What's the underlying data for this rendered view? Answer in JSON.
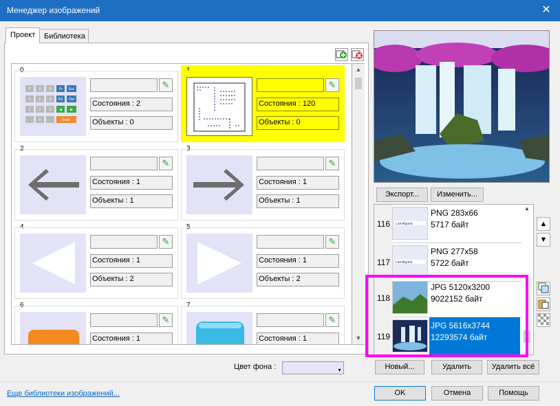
{
  "window": {
    "title": "Менеджер изображений",
    "close_glyph": "✕"
  },
  "tabs": [
    {
      "label": "Проект",
      "active": true
    },
    {
      "label": "Библиотека",
      "active": false
    }
  ],
  "cells": [
    {
      "index": "0",
      "states": "Состояния : 2",
      "objects": "Объекты : 0",
      "image": "keypad"
    },
    {
      "index": "1",
      "states": "Состояния : 120",
      "objects": "Объекты : 0",
      "image": "sheet",
      "selected": true
    },
    {
      "index": "2",
      "states": "Состояния : 1",
      "objects": "Объекты : 1",
      "image": "arrow-left"
    },
    {
      "index": "3",
      "states": "Состояния : 1",
      "objects": "Объекты : 1",
      "image": "arrow-right"
    },
    {
      "index": "4",
      "states": "Состояния : 1",
      "objects": "Объекты : 2",
      "image": "triangle-left"
    },
    {
      "index": "5",
      "states": "Состояния : 1",
      "objects": "Объекты : 2",
      "image": "triangle-right"
    },
    {
      "index": "6",
      "states": "Состояния : 1",
      "objects": "",
      "image": "orange-button"
    },
    {
      "index": "7",
      "states": "Состояния : 1",
      "objects": "",
      "image": "blue-button"
    }
  ],
  "preview_buttons": {
    "export": "Экспорт...",
    "edit": "Изменить..."
  },
  "library": [
    {
      "num": "116",
      "format": "PNG 283x66",
      "size": "5717 байт",
      "thumb_text": "Lanvtiguna"
    },
    {
      "num": "117",
      "format": "PNG 277x58",
      "size": "5722 байт",
      "thumb_text": "Lanvtiguna"
    },
    {
      "num": "118",
      "format": "JPG 5120x3200",
      "size": "9022152 байт"
    },
    {
      "num": "119",
      "format": "JPG 5616x3744",
      "size": "12293574 байт",
      "selected": true
    }
  ],
  "bottom": {
    "bg_color_label": "Цвет фона :",
    "new": "Новый...",
    "delete": "Удалить",
    "delete_all": "Удалить всё",
    "ok": "OK",
    "cancel": "Отмена",
    "help": "Помощь",
    "more_link": "Еще библиотеки изображений..."
  },
  "keypad_keys": [
    [
      "7",
      "8",
      "9",
      "Pr",
      "Esc"
    ],
    [
      "4",
      "5",
      "6",
      "BS",
      "Del"
    ],
    [
      "1",
      "2",
      "3",
      "◀",
      "▶"
    ],
    [
      "",
      "0",
      "",
      "Enter",
      ""
    ]
  ]
}
